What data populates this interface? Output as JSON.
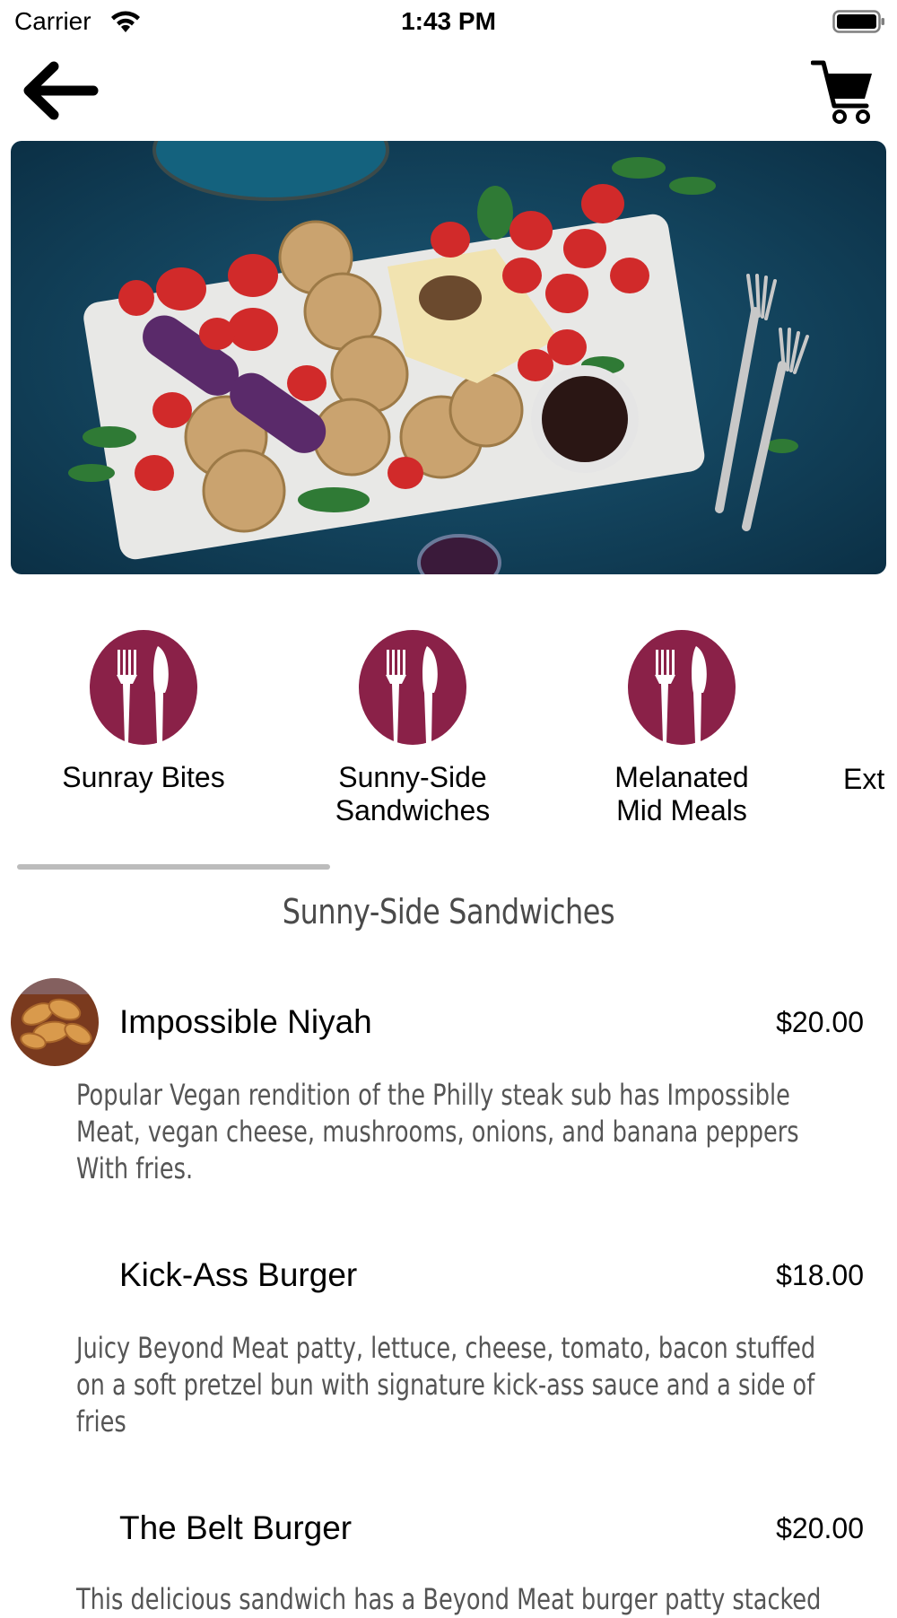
{
  "status_bar": {
    "carrier": "Carrier",
    "time": "1:43 PM",
    "icons": [
      "wifi-icon",
      "battery-icon"
    ]
  },
  "nav": {
    "back_icon": "arrow-left-icon",
    "cart_icon": "shopping-cart-icon"
  },
  "categories": [
    {
      "label_line1": "Sunray Bites",
      "label_line2": "",
      "icon": "fork-knife-icon"
    },
    {
      "label_line1": "Sunny-Side",
      "label_line2": "Sandwiches",
      "icon": "fork-knife-icon"
    },
    {
      "label_line1": "Melanated",
      "label_line2": "Mid Meals",
      "icon": "fork-knife-icon"
    },
    {
      "label_line1": "Ext",
      "label_line2": "",
      "icon": "fork-knife-icon"
    }
  ],
  "section_title": "Sunny-Side Sandwiches",
  "menu_items": [
    {
      "name": "Impossible Niyah",
      "price": "$20.00",
      "desc_lines": [
        "Popular Vegan rendition of the Philly steak sub has Impossible",
        "Meat, vegan cheese, mushrooms, onions, and banana peppers",
        "With fries."
      ]
    },
    {
      "name": "Kick-Ass Burger",
      "price": "$18.00",
      "desc_lines": [
        "Juicy Beyond Meat patty, lettuce, cheese, tomato, bacon stuffed",
        "on a soft pretzel bun with signature kick-ass sauce and a side of",
        "fries"
      ]
    },
    {
      "name": "The Belt Burger",
      "price": "$20.00",
      "desc_lines": [
        "This delicious sandwich has a Beyond Meat burger patty stacked"
      ]
    }
  ],
  "colors": {
    "category_icon": "#8a2148",
    "scroll_indicator": "#bcbcbc",
    "section_title": "#4a4a4a",
    "description": "#555555"
  }
}
